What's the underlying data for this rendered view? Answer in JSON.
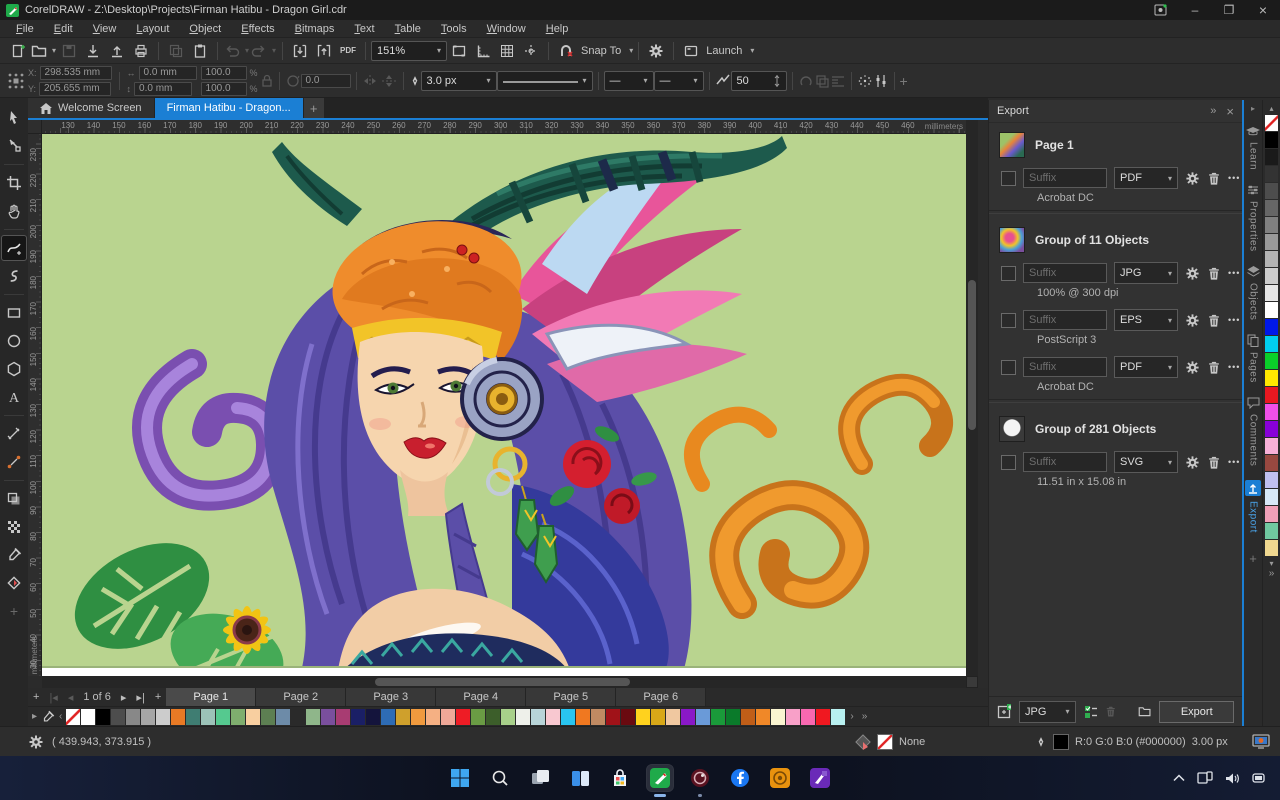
{
  "window": {
    "title": "CorelDRAW - Z:\\Desktop\\Projects\\Firman Hatibu - Dragon Girl.cdr"
  },
  "menu": {
    "items": [
      "File",
      "Edit",
      "View",
      "Layout",
      "Object",
      "Effects",
      "Bitmaps",
      "Text",
      "Table",
      "Tools",
      "Window",
      "Help"
    ]
  },
  "toolbar": {
    "zoom_level": "151%",
    "snap_label": "Snap To",
    "launch_label": "Launch",
    "pdf_label": "PDF"
  },
  "property_bar": {
    "x_label": "X:",
    "y_label": "Y:",
    "x_value": "298.535 mm",
    "y_value": "205.655 mm",
    "width_value": "0.0 mm",
    "height_value": "0.0 mm",
    "scale_x": "100.0",
    "scale_y": "100.0",
    "pct": "%",
    "angle_value": "0.0",
    "outline_width": "3.0 px",
    "line_style": "—",
    "arrow_start": "—",
    "arrow_end": "—",
    "corner_count": "50"
  },
  "doc_tabs": {
    "welcome_label": "Welcome Screen",
    "active_label": "Firman Hatibu - Dragon..."
  },
  "rulers": {
    "unit": "millimeters",
    "h_labels": [
      130,
      140,
      150,
      160,
      170,
      180,
      190,
      200,
      210,
      220,
      230,
      240,
      250,
      260,
      270,
      280,
      290,
      300,
      310,
      320,
      330,
      340,
      350,
      360,
      370,
      380,
      390,
      400,
      410,
      420,
      430,
      440,
      450,
      460
    ],
    "v_labels": [
      230,
      220,
      210,
      200,
      190,
      180,
      170,
      160,
      150,
      140,
      130,
      120,
      110,
      100,
      90,
      80,
      70,
      60,
      50,
      40,
      30
    ]
  },
  "export_panel": {
    "title": "Export",
    "suffix_placeholder": "Suffix",
    "groups": [
      {
        "name": "Page 1",
        "rows": [
          {
            "format": "PDF",
            "info": "Acrobat DC"
          }
        ]
      },
      {
        "name": "Group of 11 Objects",
        "rows": [
          {
            "format": "JPG",
            "info": "100% @ 300 dpi"
          },
          {
            "format": "EPS",
            "info": "PostScript 3"
          },
          {
            "format": "PDF",
            "info": "Acrobat DC"
          }
        ]
      },
      {
        "name": "Group of 281 Objects",
        "rows": [
          {
            "format": "SVG",
            "info": "11.51 in x 15.08 in"
          }
        ]
      }
    ],
    "footer": {
      "format": "JPG",
      "export_button": "Export"
    }
  },
  "dockers": {
    "tabs": [
      "Learn",
      "Properties",
      "Objects",
      "Pages",
      "Comments",
      "Export"
    ],
    "active": "Export"
  },
  "page_nav": {
    "counter": "1 of 6",
    "pages": [
      "Page 1",
      "Page 2",
      "Page 3",
      "Page 4",
      "Page 5",
      "Page 6"
    ],
    "active": "Page 1"
  },
  "status_bar": {
    "cursor_coords": "( 439.943, 373.915 )",
    "fill_label": "None",
    "outline_color_label": "R:0 G:0 B:0 (#000000)",
    "outline_width_label": "3.00 px"
  },
  "icons": {
    "more": "•••",
    "collapse": "»",
    "close": "×",
    "caret": "▾",
    "minimize": "–",
    "restore": "❐"
  },
  "palette_bottom": {
    "colors": [
      "none",
      "#ffffff",
      "#000000",
      "#4d4d4d",
      "#888888",
      "#a6a6a6",
      "#cccccc",
      "#e87a25",
      "#3f7d72",
      "#9cc2b8",
      "#55c98f",
      "#7fae6e",
      "#f8cfa0",
      "#5d7f52",
      "#6d8ba8",
      "#2a2a2a",
      "#8fb68a",
      "#7a4f9d",
      "#a83c72",
      "#1a1f66",
      "#14143c",
      "#2e6cb5",
      "#cfa02c",
      "#f09a3e",
      "#f5b083",
      "#efa898",
      "#ee1c25",
      "#6a9c44",
      "#3c5e2a",
      "#a8d08a",
      "#eef0ea",
      "#b8d4d8",
      "#f8c8d0",
      "#29c5f0",
      "#f07820",
      "#c08a62",
      "#a01218",
      "#6a0a10",
      "#ffd21e",
      "#d8a818",
      "#f0c8a0",
      "#8a18c8",
      "#6a9ad8",
      "#1a9a3a",
      "#0a7a2a",
      "#c05e18",
      "#f08828",
      "#faf5d0",
      "#f8a0c8",
      "#f868b0",
      "#f01820",
      "#b8f0f0"
    ]
  },
  "palette_right": {
    "colors": [
      "none",
      "#000000",
      "#1a1a1a",
      "#333333",
      "#4d4d4d",
      "#666666",
      "#808080",
      "#999999",
      "#b3b3b3",
      "#cccccc",
      "#e6e6e6",
      "#ffffff",
      "#0018e8",
      "#00cef0",
      "#0ad02a",
      "#ffe800",
      "#e81820",
      "#f050e8",
      "#8800d8",
      "#f8b0d8",
      "#984840",
      "#c0c0f0",
      "#d8e8f8",
      "#f0a0b8",
      "#70c8a0",
      "#f0d890"
    ]
  },
  "accent": {
    "active_blue": "#1b7fd4",
    "canvas_green": "#b9d48f"
  }
}
